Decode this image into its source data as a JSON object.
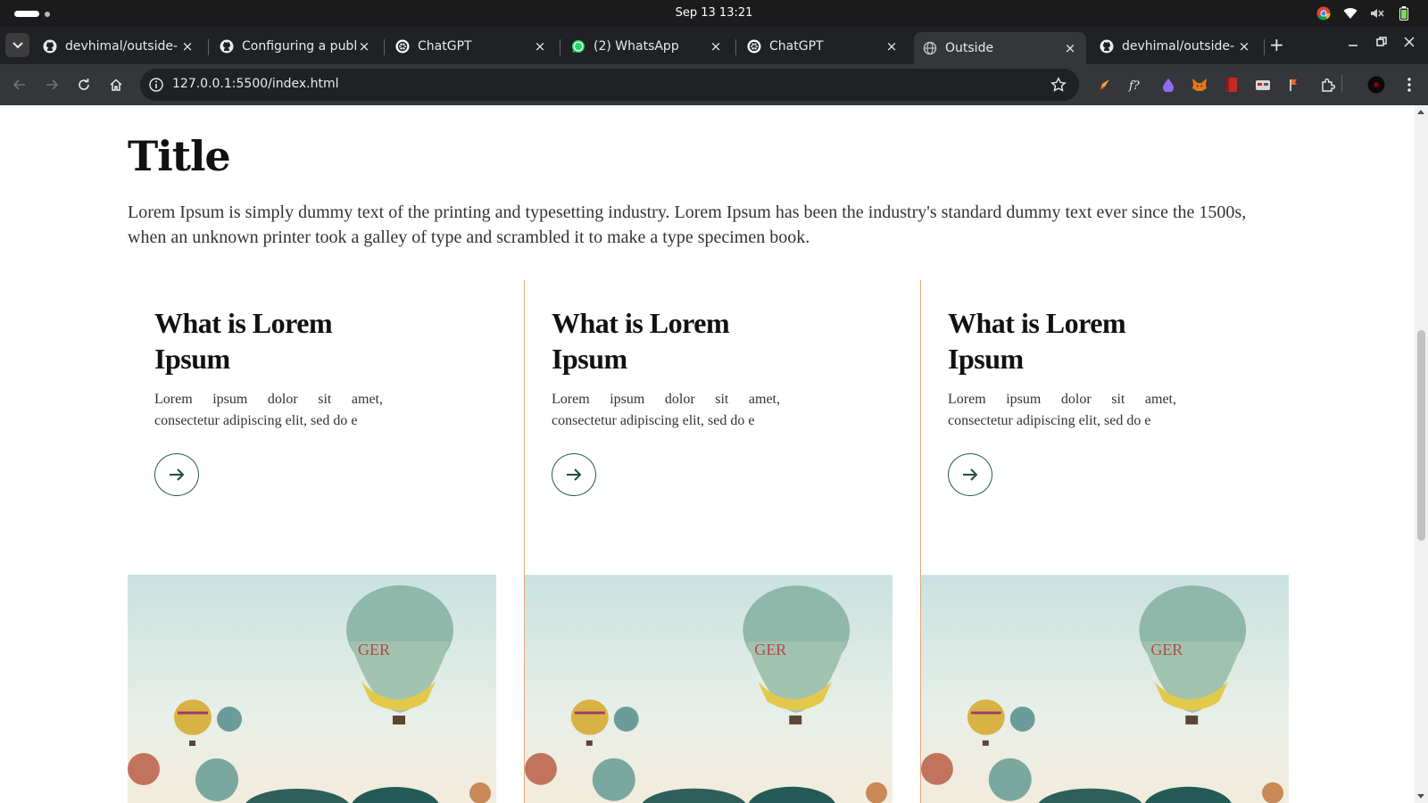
{
  "os": {
    "clock": "Sep 13  13:21"
  },
  "browser": {
    "tabs": [
      {
        "label": "devhimal/outside-",
        "favicon": "github-icon",
        "active": false
      },
      {
        "label": "Configuring a publ",
        "favicon": "github-icon",
        "active": false
      },
      {
        "label": "ChatGPT",
        "favicon": "chatgpt-icon",
        "active": false
      },
      {
        "label": "(2) WhatsApp",
        "favicon": "whatsapp-icon",
        "active": false
      },
      {
        "label": "ChatGPT",
        "favicon": "chatgpt-icon",
        "active": false
      },
      {
        "label": "Outside",
        "favicon": "globe-icon",
        "active": true
      },
      {
        "label": "devhimal/outside-",
        "favicon": "github-icon",
        "active": false
      }
    ],
    "close_glyph": "×",
    "new_tab_glyph": "+",
    "url": "127.0.0.1:5500/index.html"
  },
  "page": {
    "title": "Title",
    "intro": "Lorem Ipsum is simply dummy text of the printing and typesetting industry. Lorem Ipsum has been the industry's standard dummy text ever since the 1500s, when an unknown printer took a galley of type and scrambled it to make a type specimen book.",
    "cards": [
      {
        "title": "What is Lorem Ipsum",
        "text": "Lorem ipsum dolor sit amet, consectetur adipiscing elit, sed do e"
      },
      {
        "title": "What is Lorem Ipsum",
        "text": "Lorem ipsum dolor sit amet, consectetur adipiscing elit, sed do e"
      },
      {
        "title": "What is Lorem Ipsum",
        "text": "Lorem ipsum dolor sit amet, consectetur adipiscing elit, sed do e"
      }
    ]
  },
  "colors": {
    "accent_border": "#e6a57a",
    "arrow_green": "#1f5d4c"
  }
}
